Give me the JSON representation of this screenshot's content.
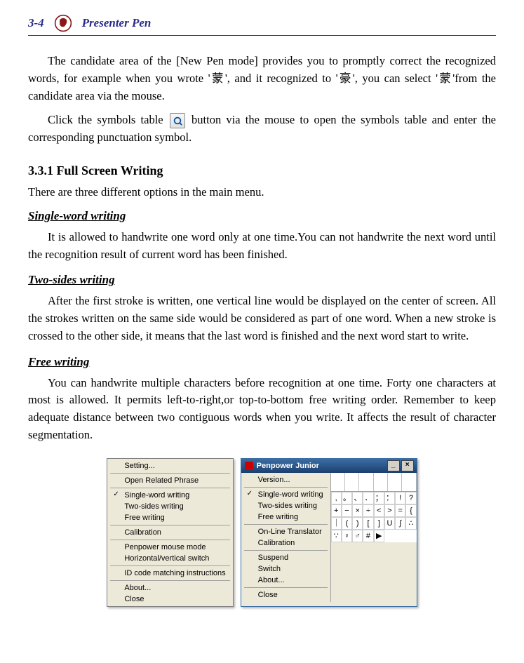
{
  "header": {
    "page_number": "3-4",
    "title": "Presenter Pen"
  },
  "paragraphs": {
    "p1": "The candidate area of the [New Pen mode] provides you to promptly correct the recognized words, for example when you wrote '蒙', and it recognized to '豪', you can select '蒙'from the candidate area via the mouse.",
    "p2a": "Click the symbols table ",
    "p2b": " button via the mouse to open the symbols table and enter the corresponding punctuation symbol."
  },
  "section": {
    "num_title": "3.3.1 Full Screen Writing",
    "intro": "There are three different options in the main menu.",
    "single_title": "Single-word writing",
    "single_body": "It is allowed to handwrite one word only at one time.You can not handwrite the next word until the recognition result of current word has been finished.",
    "two_title": "Two-sides writing",
    "two_body": "After the first stroke is written, one vertical line would be displayed on the center of screen. All the strokes written on the same side would be considered as part of one word. When a new stroke is crossed to the other side, it means that the last word is finished and the next word start to write.",
    "free_title": "Free writing",
    "free_body": "You can handwrite multiple characters before recognition at one time. Forty one characters at most is allowed. It permits left-to-right,or top-to-bottom free writing order. Remember to keep adequate distance between two contiguous words when you write. It affects the result of character segmentation."
  },
  "menu_left": {
    "items": [
      {
        "label": "Setting...",
        "checked": false
      },
      {
        "sep": true
      },
      {
        "label": "Open Related Phrase",
        "checked": false
      },
      {
        "sep": true
      },
      {
        "label": "Single-word writing",
        "checked": true
      },
      {
        "label": "Two-sides writing",
        "checked": false
      },
      {
        "label": "Free writing",
        "checked": false
      },
      {
        "sep": true
      },
      {
        "label": "Calibration",
        "checked": false
      },
      {
        "sep": true
      },
      {
        "label": "Penpower mouse mode",
        "checked": false
      },
      {
        "label": "Horizontal/vertical switch",
        "checked": false
      },
      {
        "sep": true
      },
      {
        "label": "ID code matching instructions",
        "checked": false
      },
      {
        "sep": true
      },
      {
        "label": "About...",
        "checked": false
      },
      {
        "label": "Close",
        "checked": false
      }
    ]
  },
  "win": {
    "title": "Penpower Junior",
    "minimize": "_",
    "close": "×",
    "menu_items": [
      {
        "label": "Version...",
        "checked": false
      },
      {
        "sep": true
      },
      {
        "label": "Single-word writing",
        "checked": true
      },
      {
        "label": "Two-sides writing",
        "checked": false
      },
      {
        "label": "Free writing",
        "checked": false
      },
      {
        "sep": true
      },
      {
        "label": "On-Line Translator",
        "checked": false
      },
      {
        "label": "Calibration",
        "checked": false
      },
      {
        "sep": true
      },
      {
        "label": "Suspend",
        "checked": false
      },
      {
        "label": "Switch",
        "checked": false
      },
      {
        "label": "About...",
        "checked": false
      },
      {
        "sep": true
      },
      {
        "label": "Close",
        "checked": false
      }
    ],
    "symbols": [
      ",",
      "。",
      "、",
      "．",
      "；",
      "：",
      "!",
      "?",
      "+",
      "−",
      "×",
      "÷",
      "<",
      ">",
      "=",
      "{",
      "｜",
      "(",
      ")",
      "[",
      "]",
      "U",
      "∫",
      "∴",
      "∵",
      "♀",
      "♂",
      "#",
      "▶"
    ]
  }
}
